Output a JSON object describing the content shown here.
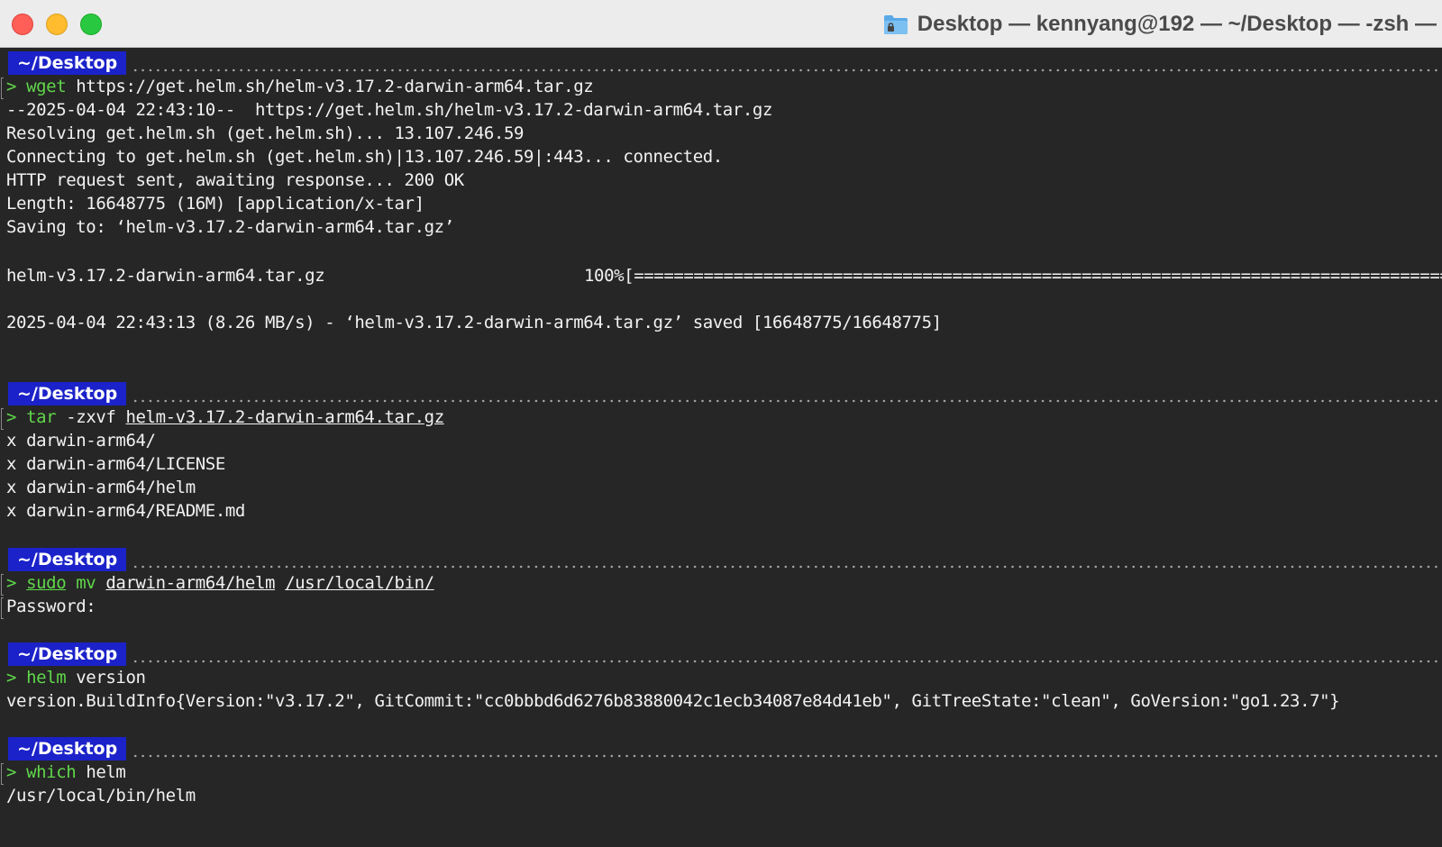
{
  "window": {
    "title": "Desktop — kennyang@192 — ~/Desktop — -zsh —",
    "icon": "folder-icon",
    "traffic_lights": {
      "close": "#ff5f57",
      "minimize": "#febc2e",
      "maximize": "#28c840"
    }
  },
  "theme": {
    "background": "#262626",
    "prompt_badge": "#1b22c9",
    "command_color": "#5fd74a"
  },
  "prompts": {
    "p1": "~/Desktop",
    "p2": "~/Desktop",
    "p3": "~/Desktop",
    "p4": "~/Desktop",
    "p5": "~/Desktop"
  },
  "cmd1": {
    "caret": "> ",
    "name": "wget",
    "args": " https://get.helm.sh/helm-v3.17.2-darwin-arm64.tar.gz"
  },
  "out1": {
    "l1": "--2025-04-04 22:43:10--  https://get.helm.sh/helm-v3.17.2-darwin-arm64.tar.gz",
    "l2": "Resolving get.helm.sh (get.helm.sh)... 13.107.246.59",
    "l3": "Connecting to get.helm.sh (get.helm.sh)|13.107.246.59|:443... connected.",
    "l4": "HTTP request sent, awaiting response... 200 OK",
    "l5": "Length: 16648775 (16M) [application/x-tar]",
    "l6": "Saving to: ‘helm-v3.17.2-darwin-arm64.tar.gz’",
    "progress_file": "helm-v3.17.2-darwin-arm64.tar.gz",
    "progress_pct": "100%[",
    "progress_bar": "=====================================================================================================",
    "l8": "2025-04-04 22:43:13 (8.26 MB/s) - ‘helm-v3.17.2-darwin-arm64.tar.gz’ saved [16648775/16648775]"
  },
  "cmd2": {
    "caret": "> ",
    "name": "tar",
    "flag": " -zxvf ",
    "file": "helm-v3.17.2-darwin-arm64.tar.gz"
  },
  "out2": {
    "l1": "x darwin-arm64/",
    "l2": "x darwin-arm64/LICENSE",
    "l3": "x darwin-arm64/helm",
    "l4": "x darwin-arm64/README.md"
  },
  "cmd3": {
    "caret": "> ",
    "sudo": "sudo",
    "mv": " mv ",
    "src": "darwin-arm64/helm",
    "sp": " ",
    "dst": "/usr/local/bin/"
  },
  "out3": {
    "l1": "Password:"
  },
  "cmd4": {
    "caret": "> ",
    "name": "helm",
    "args": " version"
  },
  "out4": {
    "l1": "version.BuildInfo{Version:\"v3.17.2\", GitCommit:\"cc0bbbd6d6276b83880042c1ecb34087e84d41eb\", GitTreeState:\"clean\", GoVersion:\"go1.23.7\"}"
  },
  "cmd5": {
    "caret": "> ",
    "name": "which",
    "args": " helm"
  },
  "out5": {
    "l1": "/usr/local/bin/helm"
  }
}
